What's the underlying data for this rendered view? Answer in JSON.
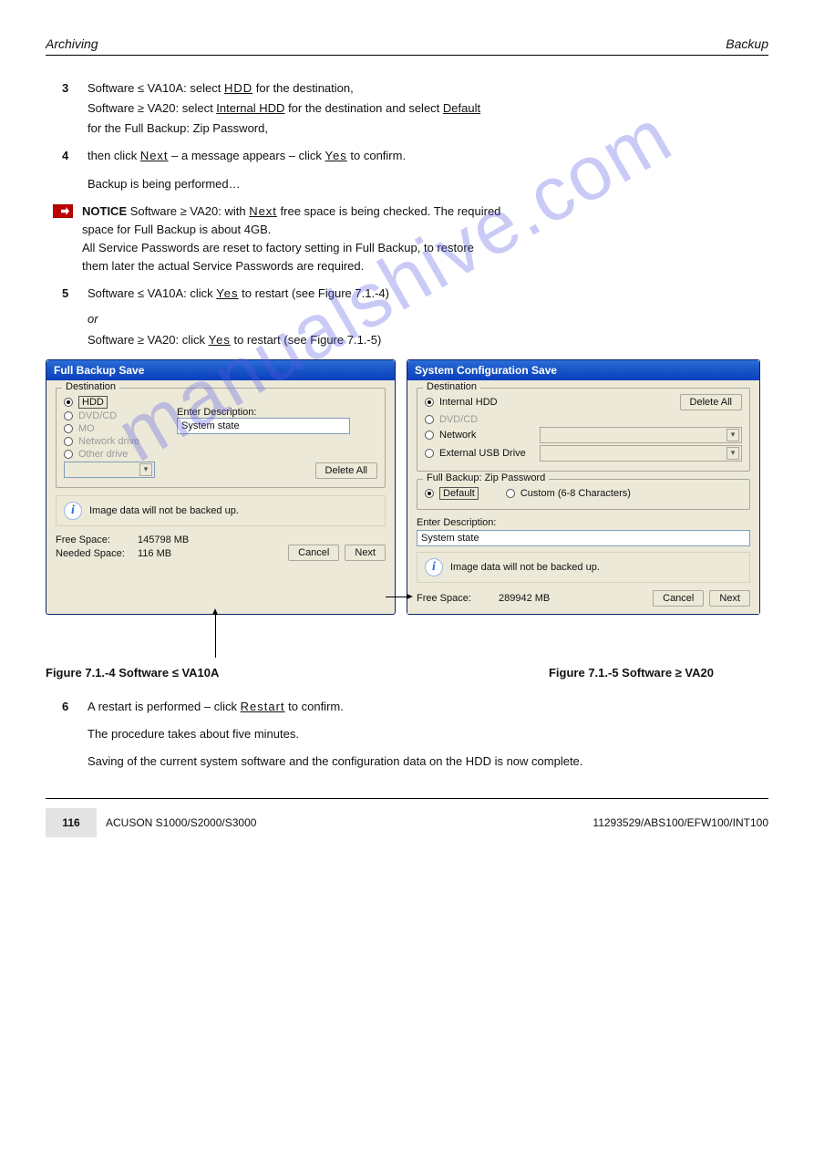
{
  "watermark": "manualshive.com",
  "header": {
    "left": "Archiving",
    "right": "Backup"
  },
  "steps": {
    "s3": {
      "num": "3",
      "t1": "Software ≤ VA10A: select  ",
      "hdd": "HDD",
      "t2": "  for the destination,",
      "t3": "Software ≥ VA20: select  ",
      "ihdd": "Internal HDD",
      "t4": "  for the destination and select  ",
      "def": "Default",
      "t5": "for the Full Backup: Zip Password,"
    },
    "s4": {
      "num": "4",
      "t1": "then click  ",
      "next": "Next",
      "t2": "  – a message appears – click  ",
      "yes": "Yes",
      "t3": "  to confirm.",
      "sub": "Backup is being performed…"
    },
    "s5": {
      "num": "5",
      "t1": "Software ≤ VA10A: click  ",
      "yes": "Yes",
      "t2": "  to restart (see Figure 7.1.-4)",
      "or": "or",
      "t3": "Software ≥ VA20: click  ",
      "t4": "  to restart (see Figure 7.1.-5)"
    },
    "s6": {
      "num": "6",
      "t1": "A restart is performed – click  ",
      "restart": "Restart",
      "t2": "  to confirm.",
      "p1": "The procedure takes about five minutes.",
      "p2": "Saving of the current system software and the configuration data on the HDD is now complete."
    }
  },
  "notice": {
    "label": "NOTICE ",
    "t1": "Software ≥ VA20: with  ",
    "next": "Next",
    "t2": "  free space is being checked. The required",
    "t3": "space for Full Backup is about 4GB.",
    "t4": "All Service Passwords are reset to factory setting in Full Backup, to restore",
    "t5": "them later the actual Service Passwords are required."
  },
  "dialogs": {
    "left": {
      "title": "Full Backup Save",
      "dest_label": "Destination",
      "opts": [
        "HDD",
        "DVD/CD",
        "MO",
        "Network drive",
        "Other drive"
      ],
      "desc_label": "Enter Description:",
      "desc_value": "System state",
      "delete_all": "Delete All",
      "info": "Image data will not be backed up.",
      "free_label": "Free Space:",
      "free_value": "145798 MB",
      "need_label": "Needed Space:",
      "need_value": "116 MB",
      "cancel": "Cancel",
      "next": "Next"
    },
    "right": {
      "title": "System Configuration Save",
      "dest_label": "Destination",
      "opts": [
        "Internal HDD",
        "DVD/CD",
        "Network",
        "External USB Drive"
      ],
      "delete_all": "Delete All",
      "zip_label": "Full Backup: Zip Password",
      "zip_default": "Default",
      "zip_custom": "Custom (6-8 Characters)",
      "desc_label": "Enter Description:",
      "desc_value": "System state",
      "info": "Image data will not be backed up.",
      "free_label": "Free Space:",
      "free_value": "289942 MB",
      "cancel": "Cancel",
      "next": "Next"
    }
  },
  "figures": {
    "left": "Figure 7.1.-4 Software ≤ VA10A",
    "right": "Figure 7.1.-5 Software ≥ VA20"
  },
  "footer": {
    "page": "116",
    "product": "ACUSON S1000/S2000/S3000",
    "doc": "11293529/ABS100/EFW100/INT100"
  }
}
